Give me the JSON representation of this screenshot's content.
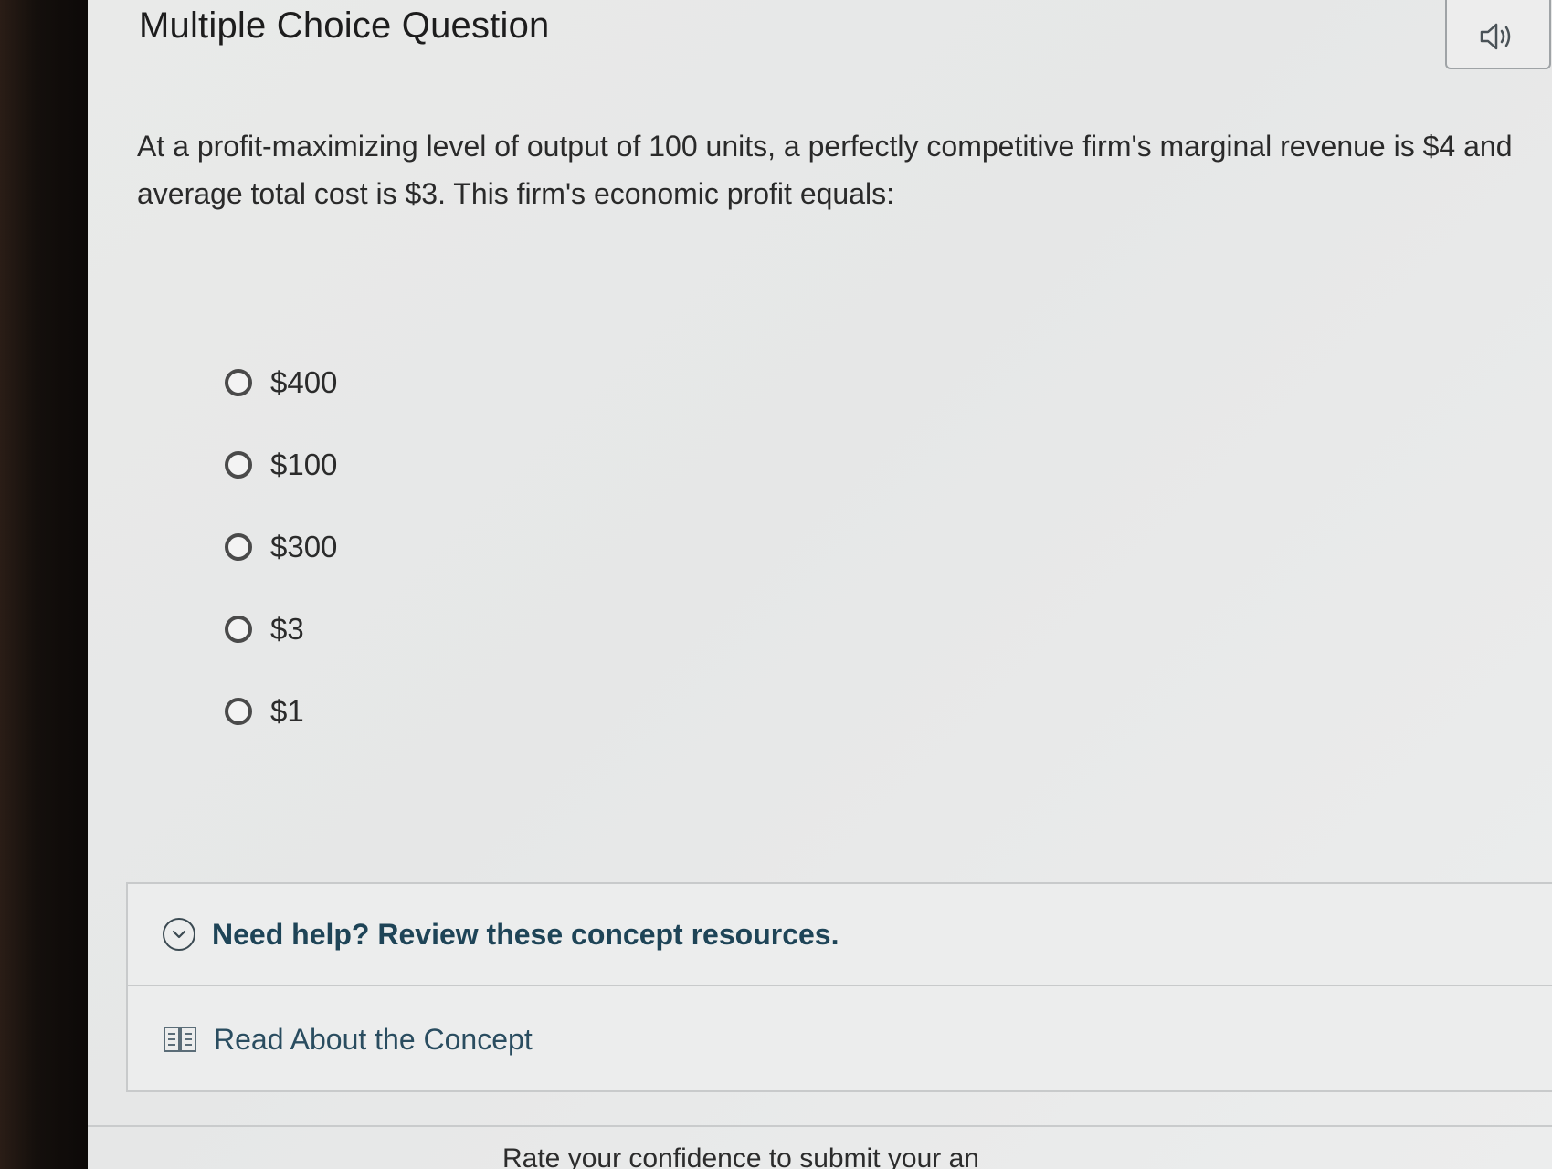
{
  "title": "Multiple Choice Question",
  "question": "At a profit-maximizing level of output of 100 units, a perfectly competitive firm's marginal revenue is $4 and average total cost is $3. This firm's economic profit equals:",
  "choices": [
    "$400",
    "$100",
    "$300",
    "$3",
    "$1"
  ],
  "help": {
    "heading": "Need help? Review these concept resources.",
    "resource_label": "Read About the Concept"
  },
  "footer": {
    "confidence_prompt": "Rate your confidence to submit your an"
  }
}
